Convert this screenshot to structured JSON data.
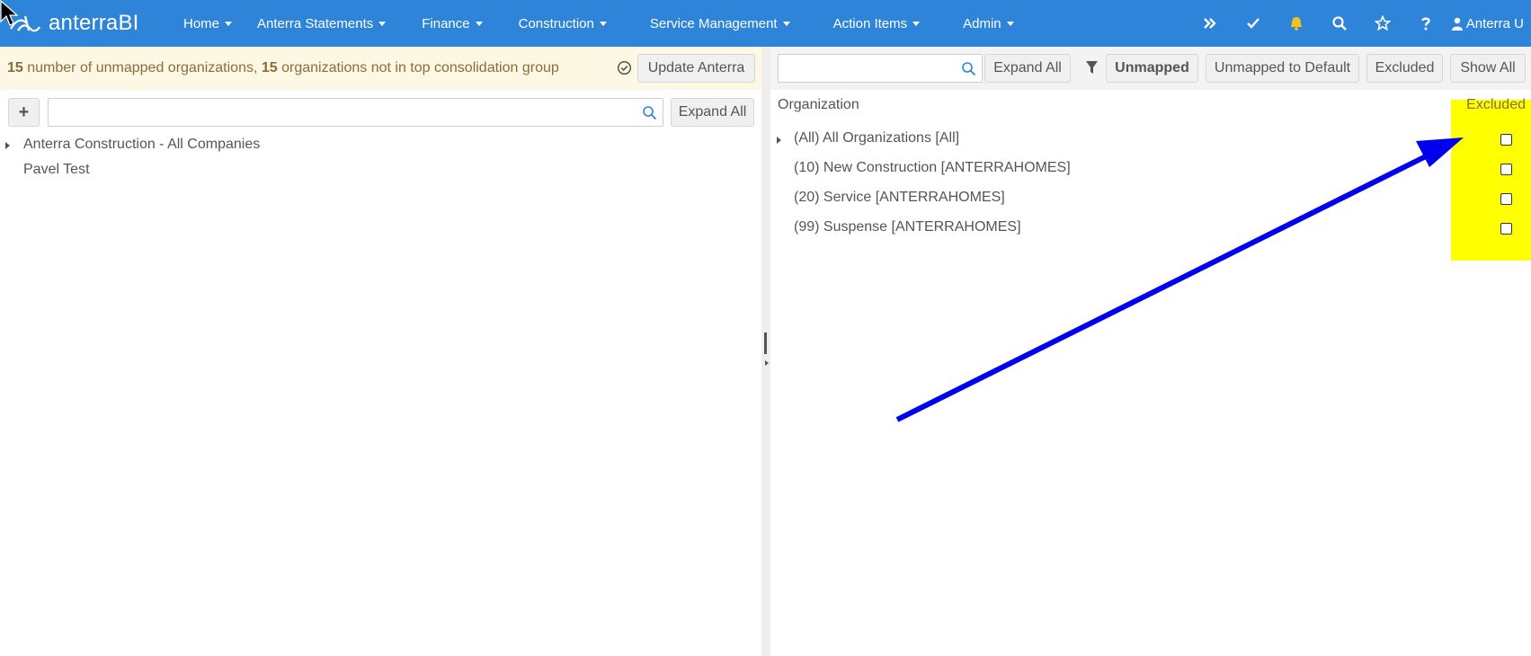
{
  "app": {
    "brand": "anterraBI"
  },
  "nav": {
    "items": [
      {
        "label": "Home"
      },
      {
        "label": "Anterra Statements"
      },
      {
        "label": "Finance"
      },
      {
        "label": "Construction"
      },
      {
        "label": "Service Management"
      },
      {
        "label": "Action Items"
      },
      {
        "label": "Admin"
      }
    ],
    "icons": [
      "double-chevron-right-icon",
      "check-icon",
      "bell-icon",
      "search-icon",
      "star-icon",
      "question-icon",
      "user-icon"
    ],
    "user_label": "Anterra U",
    "bell_color": "#f0c419",
    "bar_color": "#2e84d8"
  },
  "left": {
    "notice": {
      "count1": "15",
      "text1": " number of unmapped organizations, ",
      "count2": "15",
      "text2": " organizations not in top consolidation group",
      "background": "#fcf8e3"
    },
    "update_button": "Update Anterra",
    "add_button": "+",
    "search_placeholder": "",
    "expand_button": "Expand All",
    "tree": [
      {
        "label": "Anterra Construction - All Companies",
        "expandable": true
      },
      {
        "label": "Pavel Test",
        "expandable": false
      }
    ]
  },
  "right": {
    "search_placeholder": "",
    "toolbar": {
      "expand_all": "Expand All",
      "unmapped": "Unmapped",
      "unmapped_to_default": "Unmapped to Default",
      "excluded": "Excluded",
      "show_all": "Show All"
    },
    "columns": {
      "organization": "Organization",
      "excluded": "Excluded"
    },
    "rows": [
      {
        "label": "(All) All Organizations [All]",
        "expandable": true,
        "excluded": false
      },
      {
        "label": "(10) New Construction [ANTERRAHOMES]",
        "expandable": false,
        "excluded": false
      },
      {
        "label": "(20) Service [ANTERRAHOMES]",
        "expandable": false,
        "excluded": false
      },
      {
        "label": "(99) Suspense [ANTERRAHOMES]",
        "expandable": false,
        "excluded": false
      }
    ],
    "highlight_color": "#ffff00"
  },
  "annotation": {
    "arrow_color": "#0000ee"
  }
}
